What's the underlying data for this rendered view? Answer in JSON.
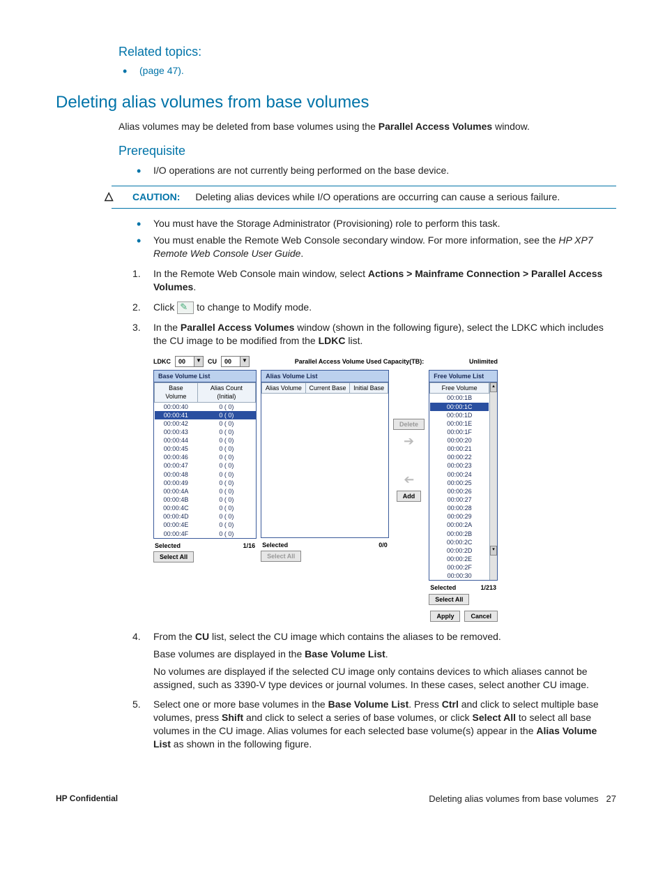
{
  "related": {
    "heading": "Related topics:",
    "item": "(page 47)."
  },
  "heading_main": "Deleting alias volumes from base volumes",
  "intro_prefix": "Alias volumes may be deleted from base volumes using the ",
  "intro_bold": "Parallel Access Volumes",
  "intro_suffix": " window.",
  "prereq_heading": "Prerequisite",
  "bullets1": "I/O operations are not currently being performed on the base device.",
  "caution": {
    "label": "CAUTION:",
    "text": "Deleting alias devices while I/O operations are occurring can cause a serious failure."
  },
  "bullets2": "You must have the Storage Administrator (Provisioning) role to perform this task.",
  "bullets3_a": "You must enable the Remote Web Console secondary window. For more information, see the ",
  "bullets3_i": "HP XP7 Remote Web Console User Guide",
  "bullets3_b": ".",
  "step1_a": "In the Remote Web Console main window, select ",
  "step1_b": "Actions > Mainframe Connection > Parallel Access Volumes",
  "step1_c": ".",
  "step2_a": "Click ",
  "step2_b": " to change to Modify mode.",
  "step3_a": "In the ",
  "step3_b": "Parallel Access Volumes",
  "step3_c": " window (shown in the following figure), select the LDKC which includes the CU image to be modified from the ",
  "step3_d": "LDKC",
  "step3_e": " list.",
  "panel": {
    "ldkc_label": "LDKC",
    "ldkc_val": "00",
    "cu_label": "CU",
    "cu_val": "00",
    "cap_label": "Parallel Access Volume Used Capacity(TB):",
    "cap_val": "Unlimited",
    "base_head": "Base Volume List",
    "alias_head": "Alias Volume List",
    "free_head": "Free Volume List",
    "bv_col1": "Base Volume",
    "bv_col2": "Alias Count (Initial)",
    "av_col1": "Alias Volume",
    "av_col2": "Current Base",
    "av_col3": "Initial Base",
    "fv_col": "Free Volume",
    "base_rows": [
      {
        "v": "00:00:40",
        "c": "0 ( 0)"
      },
      {
        "v": "00:00:41",
        "c": "0 ( 0)",
        "sel": true
      },
      {
        "v": "00:00:42",
        "c": "0 ( 0)"
      },
      {
        "v": "00:00:43",
        "c": "0 ( 0)"
      },
      {
        "v": "00:00:44",
        "c": "0 ( 0)"
      },
      {
        "v": "00:00:45",
        "c": "0 ( 0)"
      },
      {
        "v": "00:00:46",
        "c": "0 ( 0)"
      },
      {
        "v": "00:00:47",
        "c": "0 ( 0)"
      },
      {
        "v": "00:00:48",
        "c": "0 ( 0)"
      },
      {
        "v": "00:00:49",
        "c": "0 ( 0)"
      },
      {
        "v": "00:00:4A",
        "c": "0 ( 0)"
      },
      {
        "v": "00:00:4B",
        "c": "0 ( 0)"
      },
      {
        "v": "00:00:4C",
        "c": "0 ( 0)"
      },
      {
        "v": "00:00:4D",
        "c": "0 ( 0)"
      },
      {
        "v": "00:00:4E",
        "c": "0 ( 0)"
      },
      {
        "v": "00:00:4F",
        "c": "0 ( 0)"
      }
    ],
    "free_rows": [
      "00:00:1B",
      "00:00:1C",
      "00:00:1D",
      "00:00:1E",
      "00:00:1F",
      "00:00:20",
      "00:00:21",
      "00:00:22",
      "00:00:23",
      "00:00:24",
      "00:00:25",
      "00:00:26",
      "00:00:27",
      "00:00:28",
      "00:00:29",
      "00:00:2A",
      "00:00:2B",
      "00:00:2C",
      "00:00:2D",
      "00:00:2E",
      "00:00:2F",
      "00:00:30"
    ],
    "free_sel_index": 1,
    "selected_label": "Selected",
    "base_sel_count": "1/16",
    "alias_sel_count": "0/0",
    "free_sel_count": "1/213",
    "select_all": "Select All",
    "delete": "Delete",
    "add": "Add",
    "apply": "Apply",
    "cancel": "Cancel"
  },
  "step4_a": "From the ",
  "step4_b": "CU",
  "step4_c": " list, select the CU image which contains the aliases to be removed.",
  "step4_p1a": "Base volumes are displayed in the ",
  "step4_p1b": "Base Volume List",
  "step4_p1c": ".",
  "step4_p2": "No volumes are displayed if the selected CU image only contains devices to which aliases cannot be assigned, such as 3390-V type devices or journal volumes. In these cases, select another CU image.",
  "step5_a": "Select one or more base volumes in the ",
  "step5_b": "Base Volume List",
  "step5_c": ". Press ",
  "step5_d": "Ctrl",
  "step5_e": " and click to select multiple base volumes, press ",
  "step5_f": "Shift",
  "step5_g": " and click to select a series of base volumes, or click ",
  "step5_h": "Select All",
  "step5_i": " to select all base volumes in the CU image. Alias volumes for each selected base volume(s) appear in the ",
  "step5_j": "Alias Volume List",
  "step5_k": " as shown in the following figure.",
  "footer": {
    "left": "HP Confidential",
    "right_text": "Deleting alias volumes from base volumes",
    "page": "27"
  }
}
